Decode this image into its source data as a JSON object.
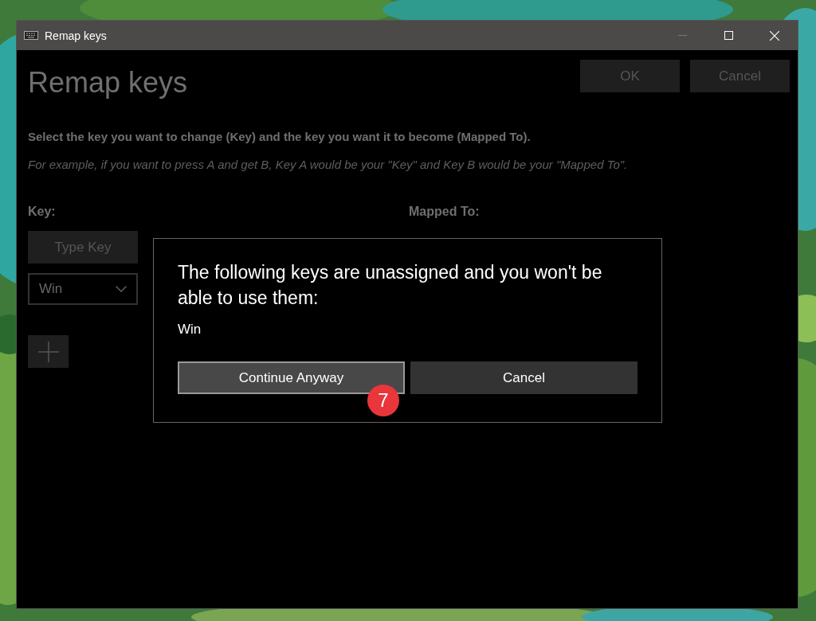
{
  "window": {
    "title": "Remap keys"
  },
  "page": {
    "heading": "Remap keys",
    "buttons": [
      "OK",
      "Cancel"
    ],
    "instruction": "Select the key you want to change (Key) and the key you want it to become (Mapped To).",
    "example": "For example, if you want to press A and get B, Key A would be your \"Key\" and Key B would be your \"Mapped To\".",
    "key_label": "Key:",
    "mapped_label": "Mapped To:",
    "type_key_button": "Type Key",
    "key_dropdown": {
      "value": "Win"
    }
  },
  "dialog": {
    "message": "The following keys are unassigned and you won't be able to use them:",
    "keys": "Win",
    "buttons": [
      {
        "label": "Continue Anyway",
        "focused": true
      },
      {
        "label": "Cancel",
        "focused": false
      }
    ]
  },
  "step_badge": "7"
}
